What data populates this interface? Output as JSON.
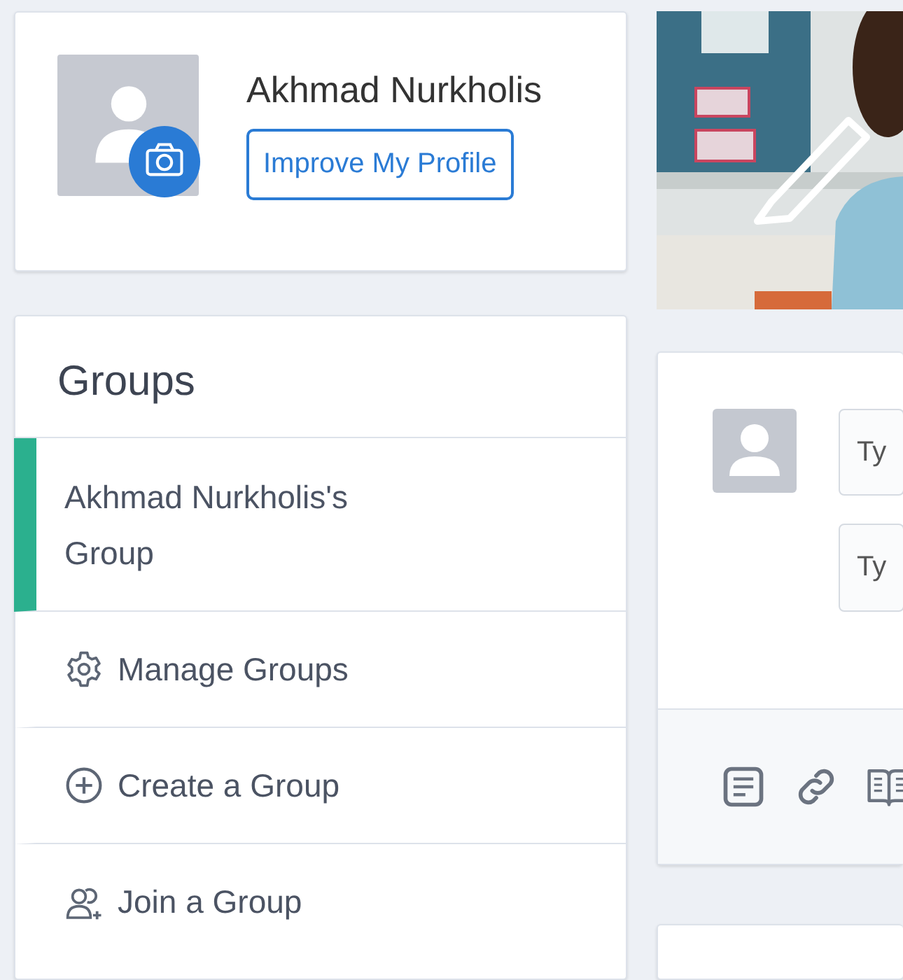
{
  "profile": {
    "name": "Akhmad Nurkholis",
    "button": "Improve My Profile"
  },
  "groups": {
    "title": "Groups",
    "items": [
      {
        "label": "Akhmad Nurkholis's Group",
        "kind": "group",
        "selected": true
      },
      {
        "label": "Manage Groups",
        "kind": "manage",
        "selected": false
      },
      {
        "label": "Create a Group",
        "kind": "create",
        "selected": false
      },
      {
        "label": "Join a Group",
        "kind": "join",
        "selected": false
      }
    ]
  },
  "composer": {
    "fields": [
      {
        "placeholder": "Ty"
      },
      {
        "placeholder": "Ty"
      }
    ],
    "tools": [
      {
        "kind": "note"
      },
      {
        "kind": "link"
      },
      {
        "kind": "book"
      }
    ]
  }
}
